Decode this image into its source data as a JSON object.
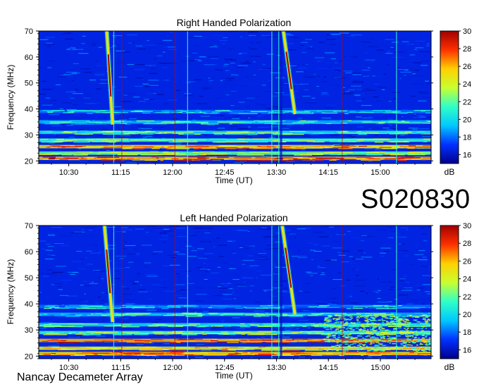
{
  "observation_id": "S020830",
  "footer": "Nancay Decameter Array",
  "colors": {
    "background": "#ffffff",
    "axis": "#000000",
    "colorbar_stops": [
      "#00008c",
      "#0030ff",
      "#00c8ff",
      "#30ffc8",
      "#c8ff30",
      "#ffd000",
      "#ff3000",
      "#a00000"
    ]
  },
  "chart_data": [
    {
      "type": "heatmap",
      "title": "Right Handed Polarization",
      "xlabel": "Time (UT)",
      "ylabel": "Frequency (MHz)",
      "x_ticks": [
        "10:30",
        "11:15",
        "12:00",
        "12:45",
        "13:30",
        "14:15",
        "15:00"
      ],
      "x_tick_minutes": [
        630,
        675,
        720,
        765,
        810,
        855,
        900
      ],
      "xlim_minutes": [
        604,
        944
      ],
      "ylim": [
        19,
        70
      ],
      "y_ticks": [
        20,
        30,
        40,
        50,
        60,
        70
      ],
      "colorbar": {
        "label": "dB",
        "range": [
          15,
          30
        ],
        "ticks": [
          16,
          18,
          20,
          22,
          24,
          26,
          28,
          30
        ]
      },
      "emission_bands": [
        {
          "freq_mhz": 21,
          "intensity_db": 28
        },
        {
          "freq_mhz": 23,
          "intensity_db": 24
        },
        {
          "freq_mhz": 25.5,
          "intensity_db": 27
        },
        {
          "freq_mhz": 28,
          "intensity_db": 23
        },
        {
          "freq_mhz": 31,
          "intensity_db": 22
        },
        {
          "freq_mhz": 35,
          "intensity_db": 21
        },
        {
          "freq_mhz": 39,
          "intensity_db": 20
        }
      ],
      "bursts": [
        {
          "start_time_min": 663,
          "start_freq_mhz": 70,
          "end_time_min": 668,
          "end_freq_mhz": 34
        },
        {
          "start_time_min": 816,
          "start_freq_mhz": 70,
          "end_time_min": 826,
          "end_freq_mhz": 38
        }
      ],
      "interference_times_min": [
        669,
        733,
        806,
        812,
        914
      ],
      "strong_interference_times_min": [
        676,
        722,
        867
      ],
      "data_gap": {
        "start_min": 813,
        "end_min": 815
      }
    },
    {
      "type": "heatmap",
      "title": "Left Handed Polarization",
      "xlabel": "Time (UT)",
      "ylabel": "Frequency (MHz)",
      "x_ticks": [
        "10:30",
        "11:15",
        "12:00",
        "12:45",
        "13:30",
        "14:15",
        "15:00"
      ],
      "x_tick_minutes": [
        630,
        675,
        720,
        765,
        810,
        855,
        900
      ],
      "xlim_minutes": [
        604,
        944
      ],
      "ylim": [
        19,
        70
      ],
      "y_ticks": [
        20,
        30,
        40,
        50,
        60,
        70
      ],
      "colorbar": {
        "label": "dB",
        "range": [
          15,
          30
        ],
        "ticks": [
          16,
          18,
          20,
          22,
          24,
          26,
          28,
          30
        ]
      },
      "emission_bands": [
        {
          "freq_mhz": 21,
          "intensity_db": 27
        },
        {
          "freq_mhz": 23,
          "intensity_db": 26
        },
        {
          "freq_mhz": 26,
          "intensity_db": 28
        },
        {
          "freq_mhz": 29,
          "intensity_db": 23
        },
        {
          "freq_mhz": 32,
          "intensity_db": 22
        },
        {
          "freq_mhz": 36,
          "intensity_db": 21
        },
        {
          "freq_mhz": 39,
          "intensity_db": 20
        }
      ],
      "bursts": [
        {
          "start_time_min": 661,
          "start_freq_mhz": 70,
          "end_time_min": 668,
          "end_freq_mhz": 33
        },
        {
          "start_time_min": 815,
          "start_freq_mhz": 70,
          "end_time_min": 826,
          "end_freq_mhz": 36
        }
      ],
      "enhanced_region": {
        "start_min": 850,
        "end_min": 944,
        "freq_min_mhz": 22,
        "freq_max_mhz": 36,
        "intensity_db": 23
      },
      "interference_times_min": [
        669,
        733,
        806,
        812,
        914
      ],
      "strong_interference_times_min": [
        676,
        722,
        867
      ],
      "data_gap": {
        "start_min": 813,
        "end_min": 815
      }
    }
  ]
}
